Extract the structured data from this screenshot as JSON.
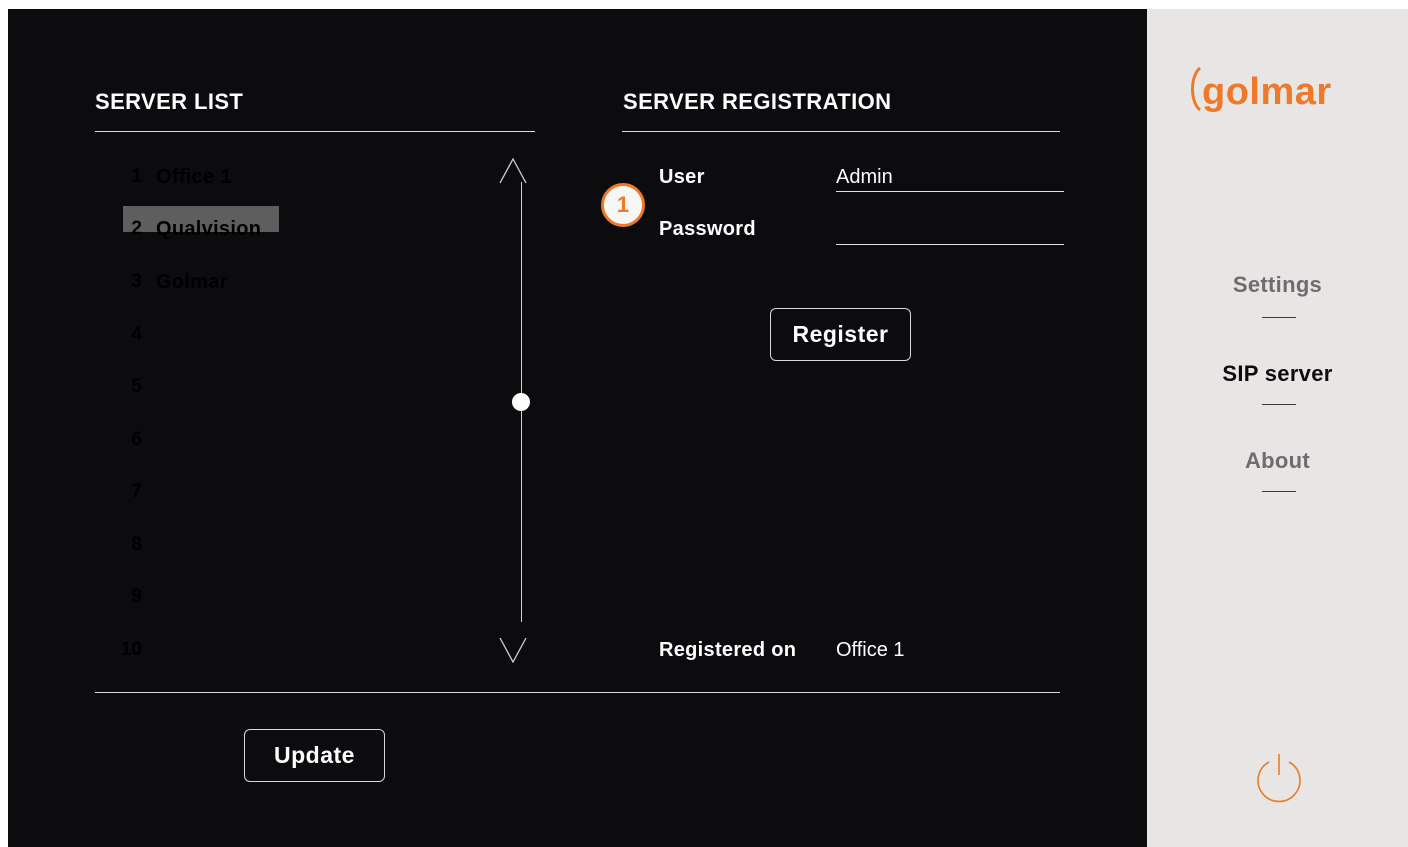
{
  "server_list": {
    "title": "SERVER LIST",
    "items": [
      {
        "num": "1",
        "name": "Office 1"
      },
      {
        "num": "2",
        "name": "Qualvision",
        "selected": true
      },
      {
        "num": "3",
        "name": "Golmar"
      },
      {
        "num": "4",
        "name": ""
      },
      {
        "num": "5",
        "name": ""
      },
      {
        "num": "6",
        "name": ""
      },
      {
        "num": "7",
        "name": ""
      },
      {
        "num": "8",
        "name": ""
      },
      {
        "num": "9",
        "name": ""
      },
      {
        "num": "10",
        "name": ""
      }
    ],
    "update_label": "Update"
  },
  "registration": {
    "title": "SERVER REGISTRATION",
    "user_label": "User",
    "user_value": "Admin",
    "password_label": "Password",
    "password_value": "",
    "register_label": "Register",
    "registered_on_label": "Registered on",
    "registered_on_value": "Office 1",
    "callout": "1"
  },
  "sidebar": {
    "logo_text": "golmar",
    "menu": [
      {
        "label": "Settings",
        "active": false
      },
      {
        "label": "SIP server",
        "active": true
      },
      {
        "label": "About",
        "active": false
      }
    ]
  },
  "colors": {
    "accent": "#ec7a2a",
    "background": "#0c0b0d",
    "sidebar": "#e7e6e4",
    "menu_active": "#0c0b0d",
    "menu_inactive": "#6d6d6d",
    "selection": "#5e5e5e"
  },
  "icons": {
    "scroll_up": "chevron-up-icon",
    "scroll_down": "chevron-down-icon",
    "power": "power-icon"
  }
}
